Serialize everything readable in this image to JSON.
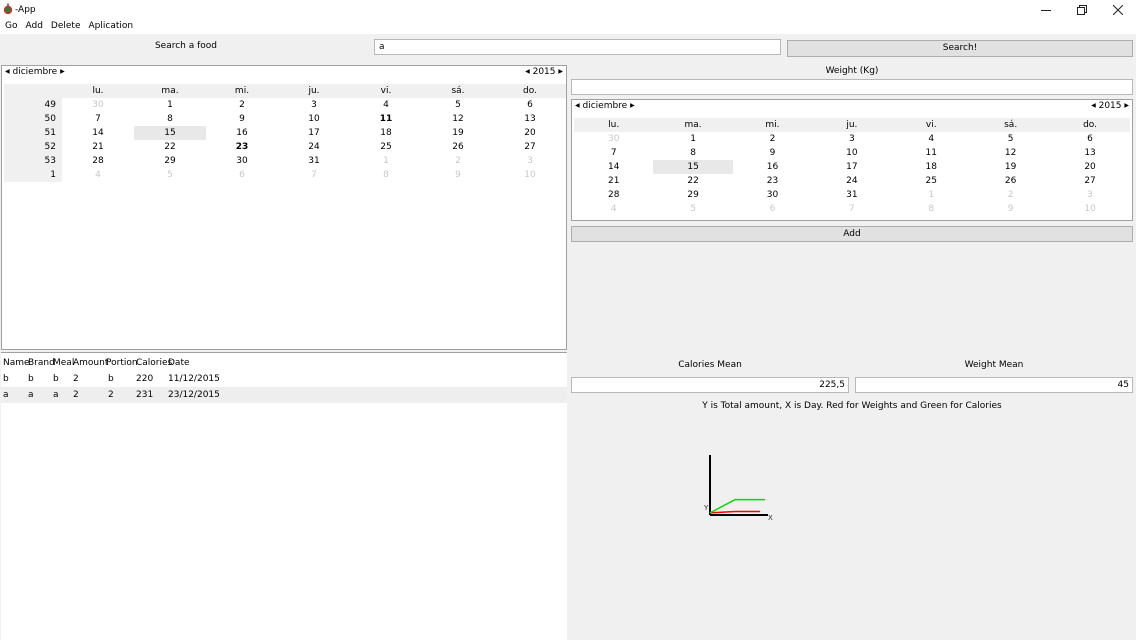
{
  "window": {
    "title": "-App",
    "minimize_icon": "minimize-icon",
    "maximize_icon": "restore-icon",
    "close_icon": "close-icon"
  },
  "menu": [
    "Go",
    "Add",
    "Delete",
    "Aplication"
  ],
  "search": {
    "label": "Search a food",
    "value": "a",
    "button": "Search!"
  },
  "left_calendar": {
    "month": "diciembre",
    "year": "2015",
    "weekdays": [
      "lu.",
      "ma.",
      "mi.",
      "ju.",
      "vi.",
      "sá.",
      "do."
    ],
    "weeks": [
      {
        "num": "49",
        "days": [
          "30",
          "1",
          "2",
          "3",
          "4",
          "5",
          "6"
        ]
      },
      {
        "num": "50",
        "days": [
          "7",
          "8",
          "9",
          "10",
          "11",
          "12",
          "13"
        ]
      },
      {
        "num": "51",
        "days": [
          "14",
          "15",
          "16",
          "17",
          "18",
          "19",
          "20"
        ]
      },
      {
        "num": "52",
        "days": [
          "21",
          "22",
          "23",
          "24",
          "25",
          "26",
          "27"
        ]
      },
      {
        "num": "53",
        "days": [
          "28",
          "29",
          "30",
          "31",
          "1",
          "2",
          "3"
        ]
      },
      {
        "num": "1",
        "days": [
          "4",
          "5",
          "6",
          "7",
          "8",
          "9",
          "10"
        ]
      }
    ]
  },
  "food_table": {
    "columns": [
      "Name",
      "Brand",
      "Meal",
      "Amount",
      "Portion",
      "Calories",
      "Date"
    ],
    "rows": [
      [
        "b",
        "b",
        "b",
        "2",
        "b",
        "220",
        "11/12/2015"
      ],
      [
        "a",
        "a",
        "a",
        "2",
        "2",
        "231",
        "23/12/2015"
      ]
    ]
  },
  "weight": {
    "label": "Weight (Kg)",
    "value": ""
  },
  "right_calendar": {
    "month": "diciembre",
    "year": "2015",
    "weekdays": [
      "lu.",
      "ma.",
      "mi.",
      "ju.",
      "vi.",
      "sá.",
      "do."
    ],
    "weeks": [
      [
        "30",
        "1",
        "2",
        "3",
        "4",
        "5",
        "6"
      ],
      [
        "7",
        "8",
        "9",
        "10",
        "11",
        "12",
        "13"
      ],
      [
        "14",
        "15",
        "16",
        "17",
        "18",
        "19",
        "20"
      ],
      [
        "21",
        "22",
        "23",
        "24",
        "25",
        "26",
        "27"
      ],
      [
        "28",
        "29",
        "30",
        "31",
        "1",
        "2",
        "3"
      ],
      [
        "4",
        "5",
        "6",
        "7",
        "8",
        "9",
        "10"
      ]
    ]
  },
  "add_button": "Add",
  "stats": {
    "calories_mean_label": "Calories Mean",
    "calories_mean_value": "225,5",
    "weight_mean_label": "Weight Mean",
    "weight_mean_value": "45"
  },
  "chart_caption": "Y is Total amount, X is Day. Red for Weights and Green for Calories",
  "chart_data": {
    "type": "line",
    "xlabel": "X",
    "ylabel": "Y",
    "series": [
      {
        "color": "#ff0000",
        "points": [
          [
            0,
            0.3
          ],
          [
            1,
            0.5
          ],
          [
            2,
            0.5
          ]
        ]
      },
      {
        "color": "#00dd00",
        "points": [
          [
            0,
            0.3
          ],
          [
            1,
            2.2
          ],
          [
            2.2,
            2.2
          ]
        ]
      }
    ],
    "colors": {
      "axes": "#000000"
    }
  }
}
